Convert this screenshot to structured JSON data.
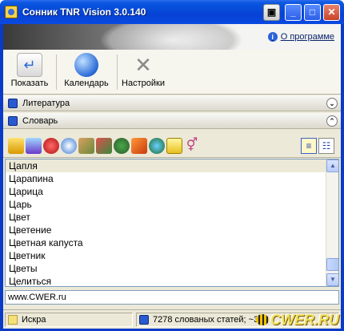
{
  "window": {
    "title": "Сонник TNR Vision 3.0.140"
  },
  "banner": {
    "about_link": "О программе"
  },
  "toolbar": {
    "show_label": "Показать",
    "calendar_label": "Календарь",
    "settings_label": "Настройки"
  },
  "sections": {
    "literature": "Литература",
    "dictionary": "Словарь"
  },
  "category_icons": [
    "sun-star-icon",
    "mask-icon",
    "strawberry-icon",
    "atom-icon",
    "tools-icon",
    "book-icon",
    "tree-icon",
    "dragon-icon",
    "globe-icon",
    "chat-icon",
    "gender-icon"
  ],
  "word_list": {
    "items": [
      "Цапля",
      "Царапина",
      "Царица",
      "Царь",
      "Цвет",
      "Цветение",
      "Цветная капуста",
      "Цветник",
      "Цветы",
      "Целиться"
    ],
    "selected_index": 0
  },
  "url_field": {
    "value": "www.CWER.ru"
  },
  "status": {
    "left_text": "Искра",
    "right_text": "7278 слованых статей; ~3"
  },
  "watermark": {
    "text": "CWER.RU"
  }
}
